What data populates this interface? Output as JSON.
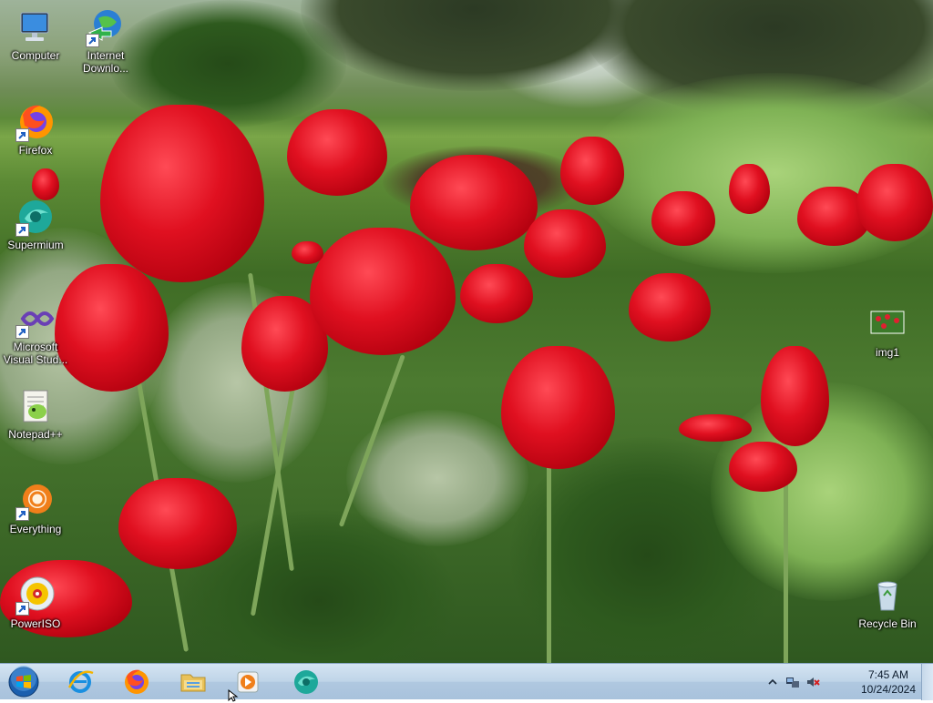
{
  "desktop": {
    "wallpaper": "red tulips garden",
    "icons": [
      {
        "id": "computer",
        "label": "Computer",
        "icon": "computer-icon",
        "shortcut": false
      },
      {
        "id": "idm",
        "label": "Internet Downlo...",
        "icon": "internet-download-manager-icon",
        "shortcut": true
      },
      {
        "id": "firefox",
        "label": "Firefox",
        "icon": "firefox-icon",
        "shortcut": true
      },
      {
        "id": "supermium",
        "label": "Supermium",
        "icon": "supermium-icon",
        "shortcut": true
      },
      {
        "id": "vs",
        "label": "Microsoft Visual Stud...",
        "icon": "visual-studio-icon",
        "shortcut": true
      },
      {
        "id": "notepadpp",
        "label": "Notepad++",
        "icon": "notepad-plus-plus-icon",
        "shortcut": false
      },
      {
        "id": "everything",
        "label": "Everything",
        "icon": "everything-search-icon",
        "shortcut": true
      },
      {
        "id": "poweriso",
        "label": "PowerISO",
        "icon": "poweriso-icon",
        "shortcut": true
      },
      {
        "id": "img1",
        "label": "img1",
        "icon": "image-file-icon",
        "shortcut": false
      },
      {
        "id": "recycle",
        "label": "Recycle Bin",
        "icon": "recycle-bin-icon",
        "shortcut": false
      }
    ]
  },
  "taskbar": {
    "start": {
      "icon": "windows-start-orb-icon"
    },
    "pinned": [
      {
        "id": "ie",
        "icon": "internet-explorer-icon"
      },
      {
        "id": "firefox",
        "icon": "firefox-icon"
      },
      {
        "id": "explorer",
        "icon": "file-explorer-folder-icon"
      },
      {
        "id": "media",
        "icon": "media-player-icon"
      },
      {
        "id": "supermium",
        "icon": "supermium-icon"
      }
    ],
    "tray": {
      "icons": [
        "show-hidden-icons-chevron-icon",
        "network-icon",
        "volume-muted-icon"
      ],
      "time": "7:45 AM",
      "date": "10/24/2024"
    }
  },
  "colors": {
    "taskbar_top": "#d4e4f2",
    "taskbar_bottom": "#a8c2dc",
    "tulip_red": "#e01020"
  }
}
